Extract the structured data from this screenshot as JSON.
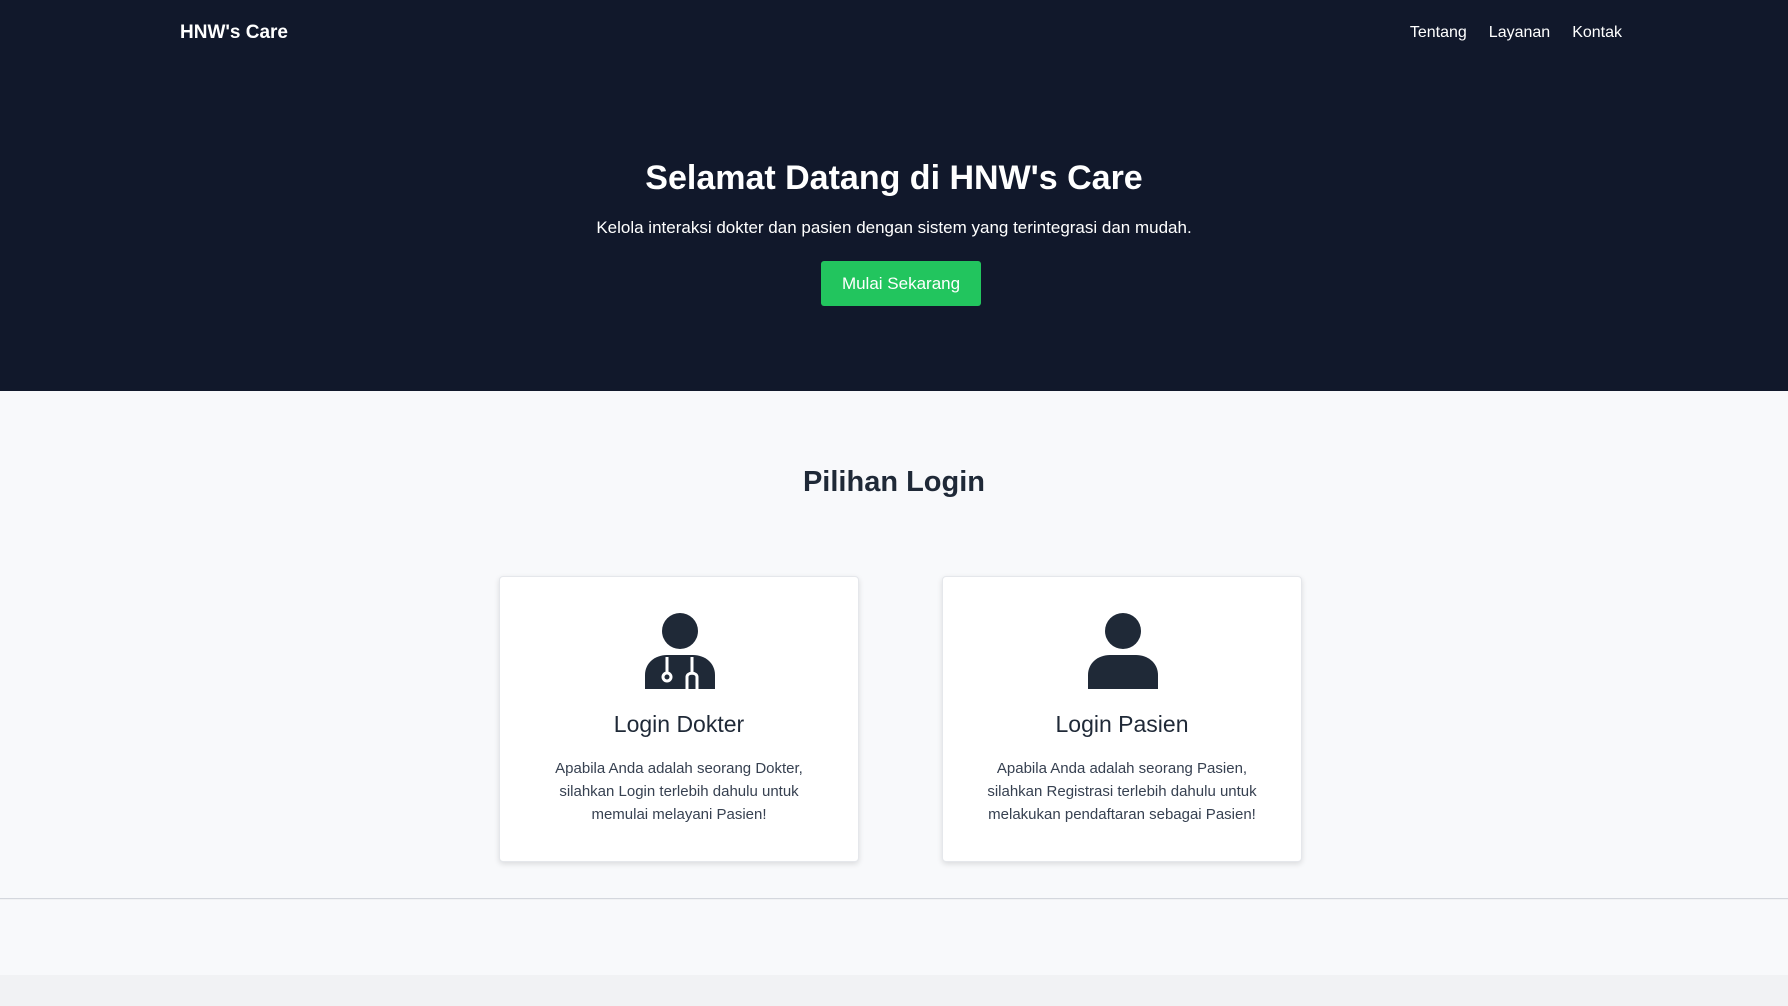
{
  "header": {
    "brand": "HNW's Care",
    "nav": [
      "Tentang",
      "Layanan",
      "Kontak"
    ]
  },
  "hero": {
    "title": "Selamat Datang di HNW's Care",
    "subtitle": "Kelola interaksi dokter dan pasien dengan sistem yang terintegrasi dan mudah.",
    "cta_label": "Mulai Sekarang"
  },
  "login": {
    "title": "Pilihan Login",
    "cards": [
      {
        "icon": "doctor-icon",
        "title": "Login Dokter",
        "description": "Apabila Anda adalah seorang Dokter, silahkan Login terlebih dahulu untuk memulai melayani Pasien!"
      },
      {
        "icon": "user-icon",
        "title": "Login Pasien",
        "description": "Apabila Anda adalah seorang Pasien, silahkan Registrasi terlebih dahulu untuk melakukan pendaftaran sebagai Pasien!"
      }
    ]
  },
  "colors": {
    "hero_bg": "#11182b",
    "accent": "#22c55e",
    "icon": "#1f2937"
  }
}
